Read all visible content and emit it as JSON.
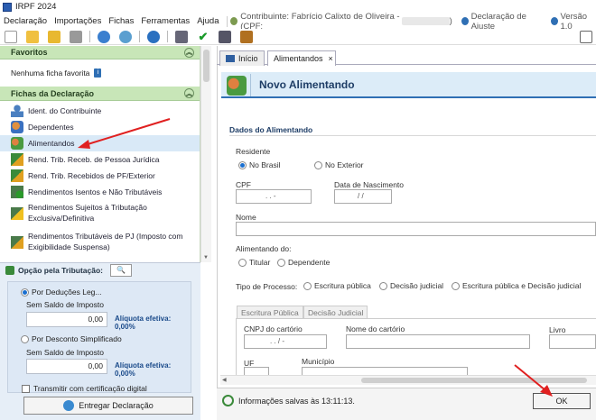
{
  "app": {
    "title": "IRPF 2024"
  },
  "menu": {
    "items": [
      "Declaração",
      "Importações",
      "Fichas",
      "Ferramentas",
      "Ajuda"
    ],
    "contributor": "Contribuinte: Fabrício Calixto de Oliveira - (CPF:",
    "declaration": "Declaração de Ajuste",
    "version": "Versão 1.0"
  },
  "favorites": {
    "title": "Favoritos",
    "empty": "Nenhuma ficha favorita"
  },
  "fichas": {
    "title": "Fichas da Declaração",
    "items": [
      "Ident. do Contribuinte",
      "Dependentes",
      "Alimentandos",
      "Rend. Trib. Receb. de Pessoa Jurídica",
      "Rend. Trib. Recebidos de PF/Exterior",
      "Rendimentos Isentos e Não Tributáveis",
      "Rendimentos Sujeitos à Tributação",
      "Exclusiva/Definitiva",
      "Rendimentos Tributáveis de PJ (Imposto com",
      "Exigibilidade Suspensa)"
    ]
  },
  "tributacao": {
    "title": "Opção pela Tributação:",
    "option1": "Por Deduções Leg...",
    "option2": "Por Desconto Simplificado",
    "saldo_label": "Sem Saldo de Imposto",
    "value1": "0,00",
    "value2": "0,00",
    "aliquota1": "Alíquota efetiva: 0,00%",
    "aliquota2": "Alíquota efetiva: 0,00%",
    "transmit": "Transmitir com certificação digital",
    "deliver": "Entregar Declaração"
  },
  "tabs": [
    {
      "label": "Início"
    },
    {
      "label": "Alimentandos",
      "close": "×"
    }
  ],
  "form": {
    "banner_title": "Novo Alimentando",
    "section": "Dados do Alimentando",
    "residente_label": "Residente",
    "residente_options": [
      "No Brasil",
      "No Exterior"
    ],
    "cpf_label": "CPF",
    "cpf_mask": ". . -",
    "nascimento_label": "Data de Nascimento",
    "nascimento_mask": "/ /",
    "nome_label": "Nome",
    "alimentando_label": "Alimentando do:",
    "alimentando_options": [
      "Titular",
      "Dependente"
    ],
    "processo_label": "Tipo de Processo:",
    "processo_options": [
      "Escritura pública",
      "Decisão judicial",
      "Escritura pública e Decisão judicial"
    ],
    "subtabs": [
      "Escritura Pública",
      "Decisão Judicial"
    ],
    "cnpj_label": "CNPJ do cartório",
    "cnpj_mask": ". . / -",
    "cartorio_label": "Nome do cartório",
    "livro_label": "Livro",
    "uf_label": "UF",
    "municipio_label": "Município"
  },
  "footer": {
    "status": "Informações salvas às 13:11:13.",
    "ok": "OK"
  },
  "colors": {
    "accent": "#2f6fb4",
    "arrow": "#e02020",
    "panel_green": "#c8e6b8"
  }
}
